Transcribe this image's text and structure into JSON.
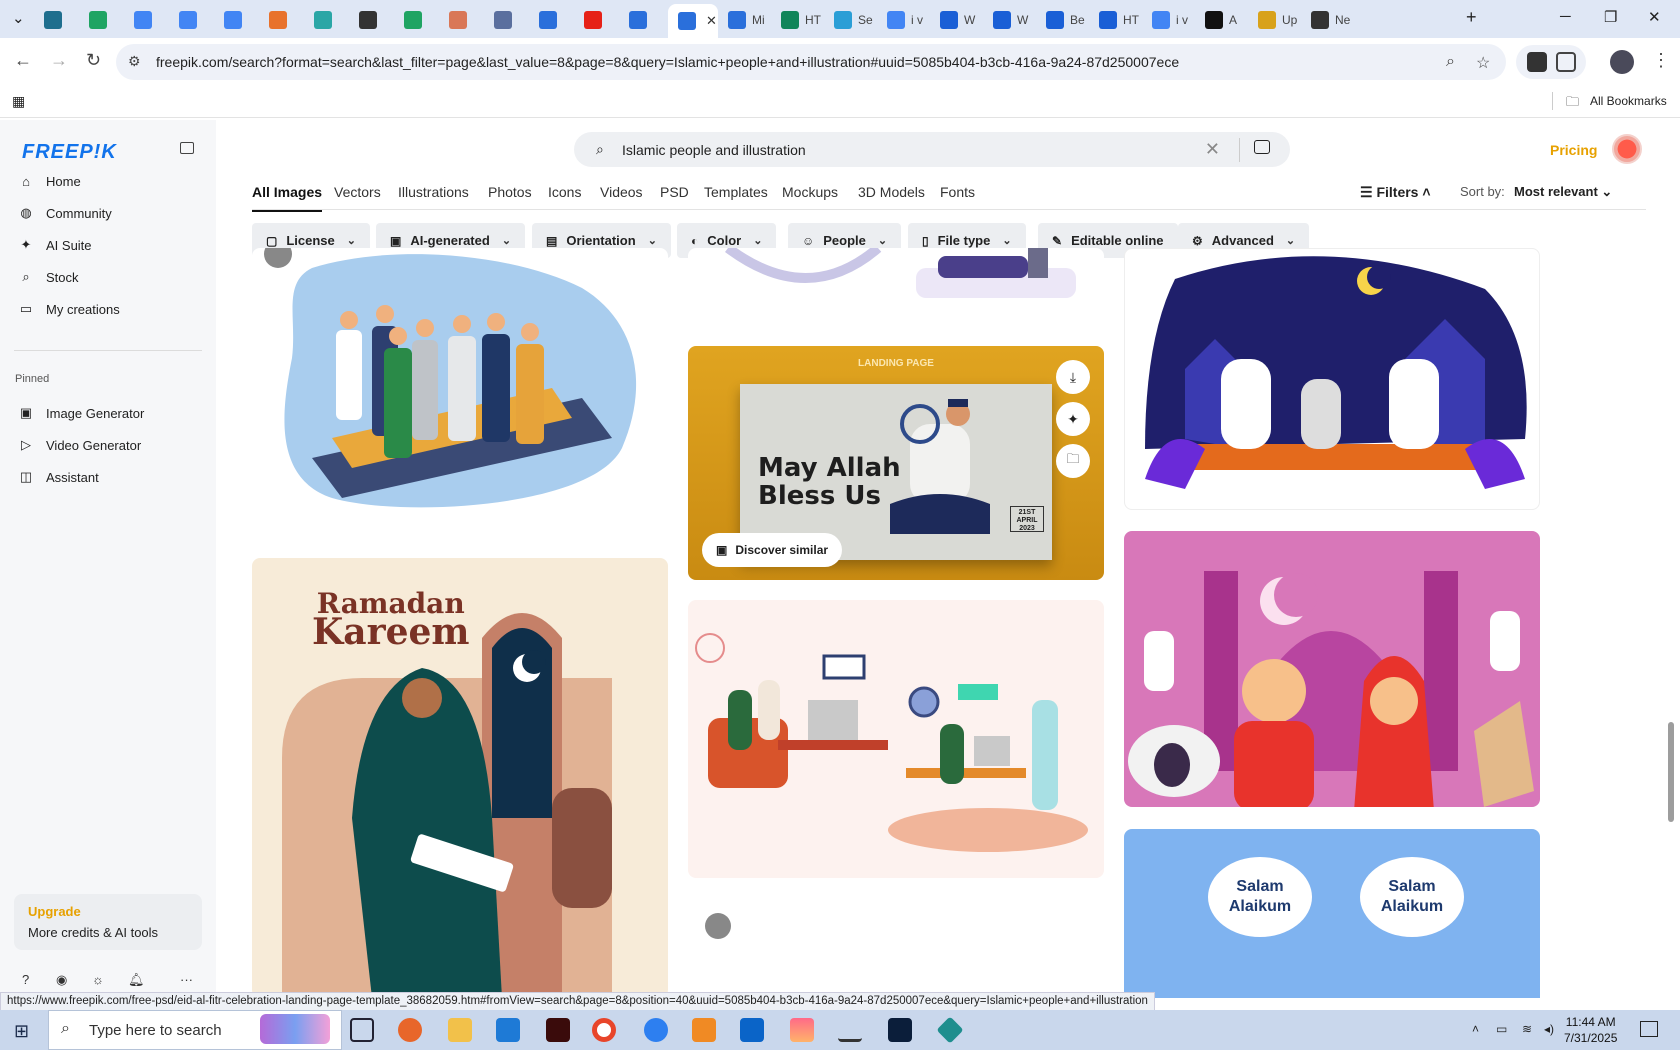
{
  "browser": {
    "tabs": [
      {
        "icon": "wordpress-icon",
        "color": "#1e6e8e",
        "title": ""
      },
      {
        "icon": "sheets-icon",
        "color": "#1fa463",
        "title": ""
      },
      {
        "icon": "docs-icon",
        "color": "#4285f4",
        "title": ""
      },
      {
        "icon": "docs-icon",
        "color": "#4285f4",
        "title": ""
      },
      {
        "icon": "docs-icon",
        "color": "#4285f4",
        "title": ""
      },
      {
        "icon": "html-icon",
        "color": "#e8722c",
        "title": ""
      },
      {
        "icon": "app-icon",
        "color": "#2aa6a6",
        "title": ""
      },
      {
        "icon": "chatgpt-icon",
        "color": "#333333",
        "title": ""
      },
      {
        "icon": "sheets-icon",
        "color": "#1fa463",
        "title": ""
      },
      {
        "icon": "claude-icon",
        "color": "#d97757",
        "title": ""
      },
      {
        "icon": "grid-icon",
        "color": "#5a6f9e",
        "title": ""
      },
      {
        "icon": "docs-icon",
        "color": "#2a6fdb",
        "title": ""
      },
      {
        "icon": "youtube-icon",
        "color": "#e62117",
        "title": ""
      },
      {
        "icon": "docs-icon",
        "color": "#2a6fdb",
        "title": ""
      },
      {
        "icon": "docs-icon",
        "color": "#2a6fdb",
        "title": "",
        "active": true
      },
      {
        "icon": "docs-icon",
        "color": "#2a6fdb",
        "title": "Mi"
      },
      {
        "icon": "w-icon",
        "color": "#11855a",
        "title": "HT"
      },
      {
        "icon": "react-icon",
        "color": "#2a9ed6",
        "title": "Se"
      },
      {
        "icon": "google-icon",
        "color": "#4285f4",
        "title": "i v"
      },
      {
        "icon": "chrome-icon",
        "color": "#1a5fd6",
        "title": "W"
      },
      {
        "icon": "chrome-icon",
        "color": "#1a5fd6",
        "title": "W"
      },
      {
        "icon": "chrome-icon",
        "color": "#1a5fd6",
        "title": "Be"
      },
      {
        "icon": "chrome-icon",
        "color": "#1a5fd6",
        "title": "HT"
      },
      {
        "icon": "google-icon",
        "color": "#4285f4",
        "title": "i v"
      },
      {
        "icon": "a-icon",
        "color": "#111111",
        "title": "A"
      },
      {
        "icon": "graduation-icon",
        "color": "#d8a21b",
        "title": "Up"
      },
      {
        "icon": "github-icon",
        "color": "#333333",
        "title": "Ne"
      }
    ],
    "new_tab": "+",
    "url": "freepik.com/search?format=search&last_filter=page&last_value=8&page=8&query=Islamic+people+and+illustration#uuid=5085b404-b3cb-416a-9a24-87d250007ece",
    "bookmarks_label": "All Bookmarks",
    "status_url": "https://www.freepik.com/free-psd/eid-al-fitr-celebration-landing-page-template_38682059.htm#fromView=search&page=8&position=40&uuid=5085b404-b3cb-416a-9a24-87d250007ece&query=Islamic+people+and+illustration"
  },
  "sidebar": {
    "logo": "FREEP!K",
    "nav": [
      {
        "label": "Home",
        "icon": "home-icon"
      },
      {
        "label": "Community",
        "icon": "globe-icon"
      },
      {
        "label": "AI Suite",
        "icon": "sparkle-icon"
      },
      {
        "label": "Stock",
        "icon": "search-icon"
      },
      {
        "label": "My creations",
        "icon": "folder-icon"
      }
    ],
    "pinned_title": "Pinned",
    "pinned": [
      {
        "label": "Image Generator",
        "icon": "image-icon"
      },
      {
        "label": "Video Generator",
        "icon": "video-icon"
      },
      {
        "label": "Assistant",
        "icon": "assistant-icon"
      }
    ],
    "upgrade_title": "Upgrade",
    "upgrade_sub": "More credits & AI tools"
  },
  "header": {
    "search_value": "Islamic people and illustration",
    "pricing": "Pricing"
  },
  "content_tabs": [
    "All Images",
    "Vectors",
    "Illustrations",
    "Photos",
    "Icons",
    "Videos",
    "PSD",
    "Templates",
    "Mockups",
    "3D Models",
    "Fonts"
  ],
  "filters_label": "Filters",
  "sort_label": "Sort by:",
  "sort_value": "Most relevant",
  "filter_buttons": [
    {
      "label": "License",
      "icon": "license-icon"
    },
    {
      "label": "AI-generated",
      "icon": "ai-icon"
    },
    {
      "label": "Orientation",
      "icon": "orientation-icon"
    },
    {
      "label": "Color",
      "icon": "palette-icon"
    },
    {
      "label": "People",
      "icon": "people-icon"
    },
    {
      "label": "File type",
      "icon": "file-icon"
    },
    {
      "label": "Editable online",
      "icon": "pencil-icon"
    },
    {
      "label": "Advanced",
      "icon": "settings-icon"
    }
  ],
  "cards": {
    "landing": {
      "header": "LANDING PAGE",
      "headline_1": "May Allah",
      "headline_2": "Bless Us",
      "date": "21ST APRIL 2023",
      "discover": "Discover similar"
    },
    "ramadan": {
      "line1": "Ramadan",
      "line2": "Kareem"
    },
    "salam": {
      "left": "Salam Alaikum",
      "right": "Salam Alaikum"
    }
  },
  "taskbar": {
    "search_placeholder": "Type here to search",
    "time": "11:44 AM",
    "date": "7/31/2025"
  },
  "colors": {
    "accent": "#1273eb",
    "pricing": "#e7a100",
    "landing_bg": "#d99a1f",
    "pink_bg": "#d877b9",
    "blue_bg": "#7fb3f0"
  }
}
